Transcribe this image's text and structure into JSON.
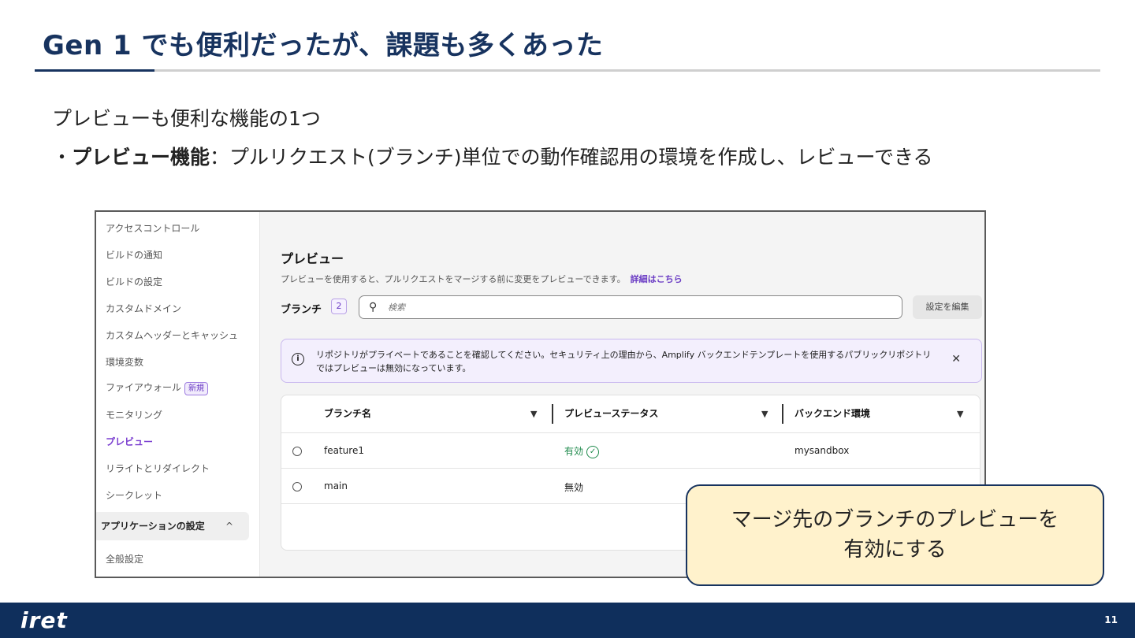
{
  "slide": {
    "title": "Gen 1 でも便利だったが、課題も多くあった",
    "intro": "プレビューも便利な機能の1つ",
    "bullet_prefix": "・",
    "bullet_bold": "プレビュー機能",
    "bullet_text": "：プルリクエスト(ブランチ)単位での動作確認用の環境を作成し、レビューできる",
    "callout_line1": "マージ先のブランチのプレビューを",
    "callout_line2": "有効にする",
    "page_number": "11",
    "logo": "iret"
  },
  "sidebar": {
    "items": [
      {
        "label": "アクセスコントロール"
      },
      {
        "label": "ビルドの通知"
      },
      {
        "label": "ビルドの設定"
      },
      {
        "label": "カスタムドメイン"
      },
      {
        "label": "カスタムヘッダーとキャッシュ"
      },
      {
        "label": "環境変数"
      },
      {
        "label": "ファイアウォール",
        "badge": "新規"
      },
      {
        "label": "モニタリング"
      },
      {
        "label": "プレビュー",
        "active": true
      },
      {
        "label": "リライトとリダイレクト"
      },
      {
        "label": "シークレット"
      }
    ],
    "section": "アプリケーションの設定",
    "section_chevron": "^",
    "after_section": "全般設定"
  },
  "preview": {
    "title": "プレビュー",
    "description": "プレビューを使用すると、プルリクエストをマージする前に変更をプレビューできます。",
    "link": "詳細はこちら",
    "branch_label": "ブランチ",
    "branch_count": "2",
    "search_placeholder": "検索",
    "edit_button": "設定を編集",
    "alert_text": "リポジトリがプライベートであることを確認してください。セキュリティ上の理由から、Amplify バックエンドテンプレートを使用するパブリックリポジトリではプレビューは無効になっています。",
    "columns": [
      "ブランチ名",
      "プレビューステータス",
      "バックエンド環境"
    ],
    "rows": [
      {
        "branch": "feature1",
        "status": "有効",
        "backend": "mysandbox"
      },
      {
        "branch": "main",
        "status": "無効",
        "backend": ""
      }
    ]
  },
  "colors": {
    "title": "#17335f",
    "accent": "#7b3fd0",
    "enabled": "#1f8a4c",
    "callout_bg": "#fff2cc",
    "footer": "#0f2f5c"
  }
}
